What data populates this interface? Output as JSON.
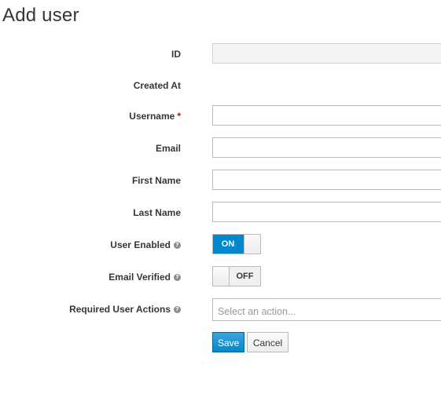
{
  "page": {
    "title": "Add user"
  },
  "form": {
    "fields": {
      "id": {
        "label": "ID",
        "value": ""
      },
      "created_at": {
        "label": "Created At",
        "value": ""
      },
      "username": {
        "label": "Username",
        "required_mark": "*",
        "value": ""
      },
      "email": {
        "label": "Email",
        "value": ""
      },
      "first_name": {
        "label": "First Name",
        "value": ""
      },
      "last_name": {
        "label": "Last Name",
        "value": ""
      },
      "user_enabled": {
        "label": "User Enabled",
        "help_icon": "question-circle-icon",
        "state": "ON",
        "value": true
      },
      "email_verified": {
        "label": "Email Verified",
        "help_icon": "question-circle-icon",
        "state": "OFF",
        "value": false
      },
      "required_actions": {
        "label": "Required User Actions",
        "help_icon": "question-circle-icon",
        "placeholder": "Select an action..."
      }
    },
    "buttons": {
      "save": "Save",
      "cancel": "Cancel"
    },
    "help_glyph": "?"
  },
  "colors": {
    "accent": "#0088ce",
    "required": "#cc0000",
    "text": "#363636",
    "placeholder": "#999999"
  }
}
